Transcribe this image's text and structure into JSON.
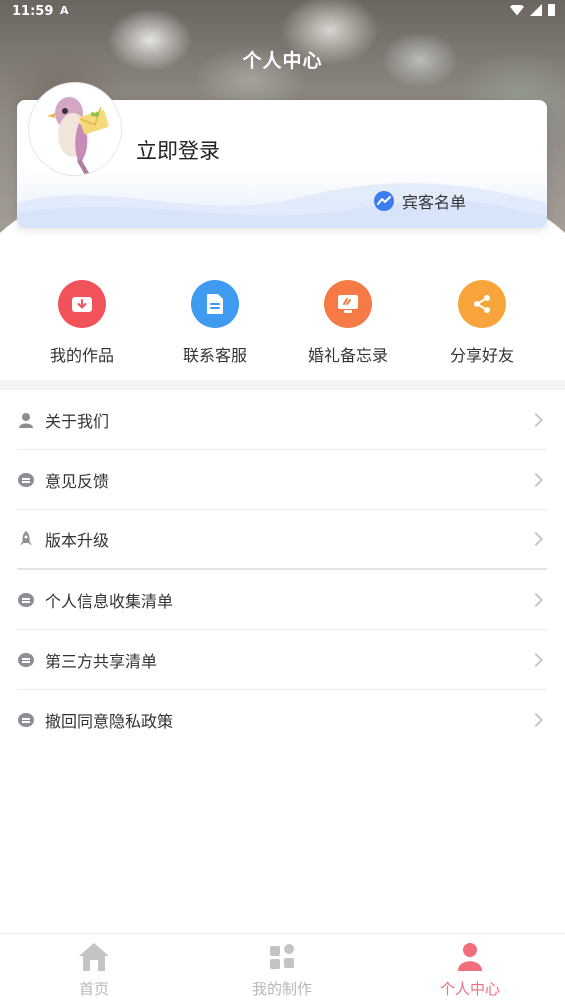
{
  "status_bar": {
    "time": "11:59",
    "notification_glyph": "A"
  },
  "header": {
    "title": "个人中心"
  },
  "profile": {
    "login_label": "立即登录",
    "guest_list_label": "宾客名单",
    "guest_icon": "chart-trend-icon"
  },
  "actions": [
    {
      "label": "我的作品",
      "icon": "download-icon",
      "color": "#f2535b"
    },
    {
      "label": "联系客服",
      "icon": "document-icon",
      "color": "#3e9bf0"
    },
    {
      "label": "婚礼备忘录",
      "icon": "monitor-icon",
      "color": "#f57a45"
    },
    {
      "label": "分享好友",
      "icon": "share-icon",
      "color": "#f8a43a"
    }
  ],
  "menu": [
    {
      "label": "关于我们",
      "icon": "user-icon"
    },
    {
      "label": "意见反馈",
      "icon": "chat-bubble-icon"
    },
    {
      "label": "版本升级",
      "icon": "rocket-icon"
    },
    {
      "label": "个人信息收集清单",
      "icon": "chat-bubble-icon"
    },
    {
      "label": "第三方共享清单",
      "icon": "chat-bubble-icon"
    },
    {
      "label": "撤回同意隐私政策",
      "icon": "chat-bubble-icon"
    }
  ],
  "bottom_nav": [
    {
      "label": "首页",
      "icon": "home-icon",
      "active": false
    },
    {
      "label": "我的制作",
      "icon": "grid-icon",
      "active": false
    },
    {
      "label": "个人中心",
      "icon": "person-icon",
      "active": true
    }
  ],
  "colors": {
    "accent": "#f26d7d",
    "inactive": "#b8b8b8",
    "guest_icon": "#3d7cf0"
  }
}
